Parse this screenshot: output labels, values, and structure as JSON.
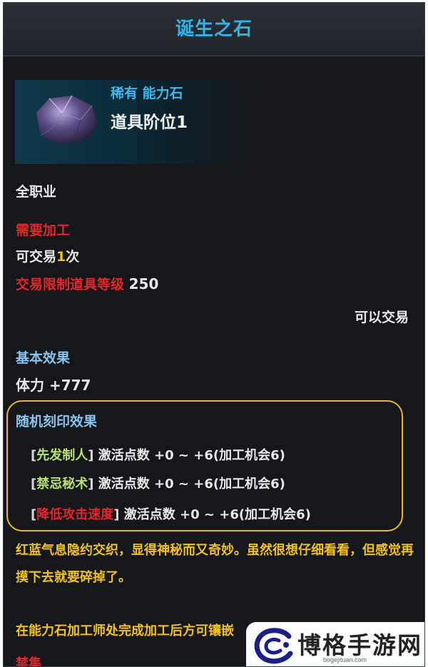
{
  "title": "诞生之石",
  "item": {
    "rarity": "稀有 能力石",
    "tier": "道具阶位1",
    "icon": "amethyst-stone-icon"
  },
  "info": {
    "class_req": "全职业",
    "needs_processing": "需要加工",
    "tradeable_prefix": "可交易",
    "tradeable_count": "1",
    "tradeable_suffix": "次",
    "trade_limit_label": "交易限制道具等级",
    "trade_limit_value": "250",
    "trade_status": "可以交易"
  },
  "basic": {
    "header": "基本效果",
    "stat": "体力 +777"
  },
  "random": {
    "header": "随机刻印效果",
    "options": [
      {
        "name": "先发制人",
        "value": "激活点数 +0 ~ +6(加工机会6)",
        "color": "#b7e06e"
      },
      {
        "name": "禁忌秘术",
        "value": "激活点数 +0 ~ +6(加工机会6)",
        "color": "#b7e06e"
      },
      {
        "name": "降低攻击速度",
        "value": "激活点数 +0 ~ +6(加工机会6)",
        "color": "#e3262a"
      }
    ]
  },
  "flavor": {
    "text": "红蓝气息隐约交织，显得神秘而又奇妙。虽然很想仔细看看，但感觉再摸下去就要碎掉了。",
    "note": "在能力石加工师处完成加工后方可镶嵌",
    "partial": "禁集"
  },
  "watermark": {
    "name": "博格手游网",
    "url": "bogejituan.com"
  },
  "colors": {
    "title": "#2fb4ea",
    "warning": "#e3262a",
    "highlight": "#f2c21a",
    "section": "#86c4ee",
    "frame": "#f2b61a"
  }
}
